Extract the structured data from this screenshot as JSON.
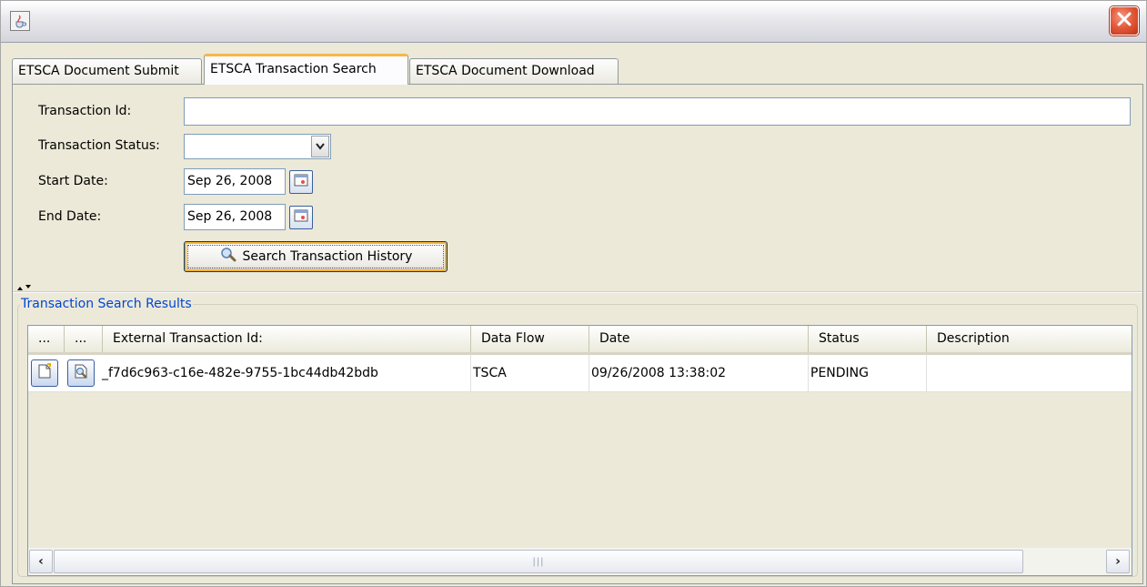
{
  "window": {
    "app_icon": "java-cup-icon",
    "close_icon": "close-icon"
  },
  "tabs": [
    {
      "label": "ETSCA Document Submit",
      "active": false
    },
    {
      "label": "ETSCA Transaction Search",
      "active": true
    },
    {
      "label": "ETSCA Document Download",
      "active": false
    }
  ],
  "form": {
    "transaction_id_label": "Transaction Id:",
    "transaction_id_value": "",
    "transaction_status_label": "Transaction Status:",
    "transaction_status_value": "",
    "start_date_label": "Start Date:",
    "start_date_value": "Sep 26, 2008",
    "end_date_label": "End Date:",
    "end_date_value": "Sep 26, 2008",
    "search_button_label": "Search Transaction History",
    "calendar_icon": "calendar-icon",
    "search_icon": "magnifier-icon"
  },
  "results": {
    "group_title": "Transaction Search Results",
    "columns": [
      "...",
      "...",
      "External Transaction Id:",
      "Data Flow",
      "Date",
      "Status",
      "Description"
    ],
    "rows": [
      {
        "external_transaction_id": "_f7d6c963-c16e-482e-9755-1bc44db42bdb",
        "data_flow": "TSCA",
        "date": "09/26/2008 13:38:02",
        "status": "PENDING",
        "description": ""
      }
    ],
    "row_action_icons": [
      "document-edit-icon",
      "document-search-icon"
    ]
  },
  "colors": {
    "window_bg": "#ece9d8",
    "active_tab_accent": "#f7b64c",
    "group_title": "#0046d5",
    "close_button": "#e45c3c"
  }
}
